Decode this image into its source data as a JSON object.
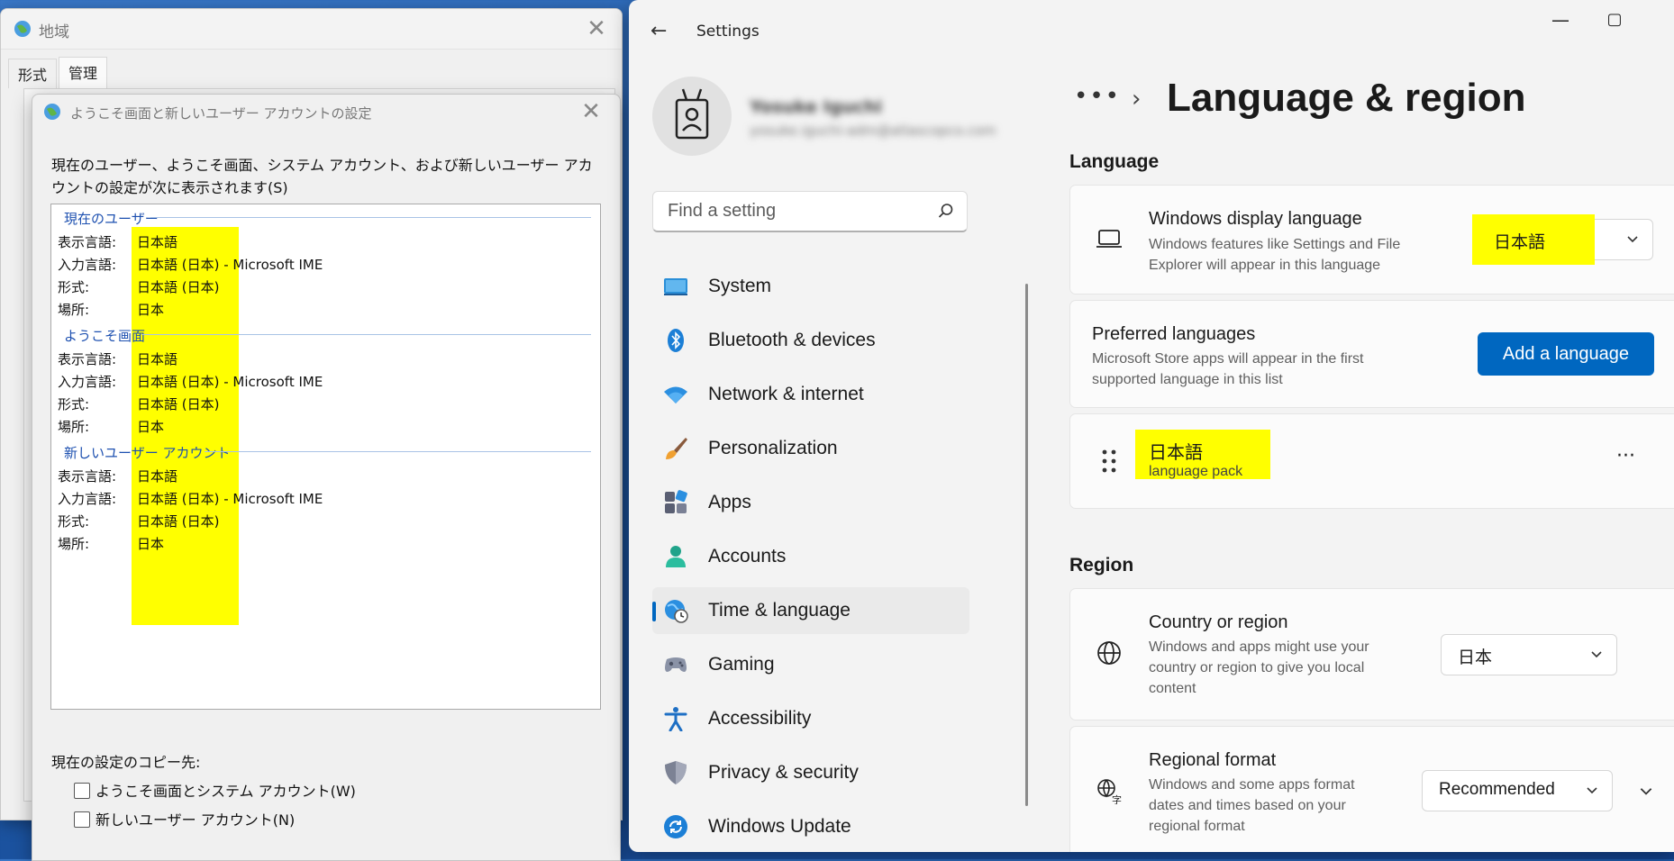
{
  "region_dialog": {
    "title": "地域",
    "tabs": [
      "形式",
      "管理"
    ]
  },
  "welcome_dialog": {
    "title": "ようこそ画面と新しいユーザー アカウントの設定",
    "description": "現在のユーザー、ようこそ画面、システム アカウント、および新しいユーザー アカウントの設定が次に表示されます(S)",
    "sections": [
      {
        "heading": "現在のユーザー",
        "rows": [
          {
            "label": "表示言語:",
            "value": "日本語",
            "extra": ""
          },
          {
            "label": "入力言語:",
            "value": "日本語 (日本)",
            "extra": " - Microsoft IME"
          },
          {
            "label": "形式:",
            "value": "日本語 (日本)",
            "extra": ""
          },
          {
            "label": "場所:",
            "value": "日本",
            "extra": ""
          }
        ]
      },
      {
        "heading": "ようこそ画面",
        "rows": [
          {
            "label": "表示言語:",
            "value": "日本語",
            "extra": ""
          },
          {
            "label": "入力言語:",
            "value": "日本語 (日本)",
            "extra": " - Microsoft IME"
          },
          {
            "label": "形式:",
            "value": "日本語 (日本)",
            "extra": ""
          },
          {
            "label": "場所:",
            "value": "日本",
            "extra": ""
          }
        ]
      },
      {
        "heading": "新しいユーザー アカウント",
        "rows": [
          {
            "label": "表示言語:",
            "value": "日本語",
            "extra": ""
          },
          {
            "label": "入力言語:",
            "value": "日本語 (日本)",
            "extra": " - Microsoft IME"
          },
          {
            "label": "形式:",
            "value": "日本語 (日本)",
            "extra": ""
          },
          {
            "label": "場所:",
            "value": "日本",
            "extra": ""
          }
        ]
      }
    ],
    "copy_label": "現在の設定のコピー先:",
    "checkbox_welcome": "ようこそ画面とシステム アカウント(W)",
    "checkbox_newuser": "新しいユーザー アカウント(N)"
  },
  "settings": {
    "app_title": "Settings",
    "user_name": "Yosuke Iguchi",
    "user_email": "yosuke.iguchi-adm@atlascopco.com",
    "search_placeholder": "Find a setting",
    "nav": [
      {
        "label": "System",
        "icon": "system-icon"
      },
      {
        "label": "Bluetooth & devices",
        "icon": "bluetooth-icon"
      },
      {
        "label": "Network & internet",
        "icon": "wifi-icon"
      },
      {
        "label": "Personalization",
        "icon": "brush-icon"
      },
      {
        "label": "Apps",
        "icon": "apps-icon"
      },
      {
        "label": "Accounts",
        "icon": "accounts-icon"
      },
      {
        "label": "Time & language",
        "icon": "time-language-icon",
        "selected": true
      },
      {
        "label": "Gaming",
        "icon": "gamepad-icon"
      },
      {
        "label": "Accessibility",
        "icon": "accessibility-icon"
      },
      {
        "label": "Privacy & security",
        "icon": "shield-icon"
      },
      {
        "label": "Windows Update",
        "icon": "update-icon"
      }
    ],
    "breadcrumb_more": "•••",
    "page_title": "Language & region",
    "language_section": "Language",
    "display_language": {
      "title": "Windows display language",
      "subtitle": "Windows features like Settings and File Explorer will appear in this language",
      "value": "日本語"
    },
    "preferred_languages": {
      "title": "Preferred languages",
      "subtitle": "Microsoft Store apps will appear in the first supported language in this list",
      "button": "Add a language"
    },
    "language_item": {
      "name": "日本語",
      "detail": "language pack"
    },
    "region_section": "Region",
    "country": {
      "title": "Country or region",
      "subtitle": "Windows and apps might use your country or region to give you local content",
      "value": "日本"
    },
    "regional_format": {
      "title": "Regional format",
      "subtitle": "Windows and some apps format dates and times based on your regional format",
      "value": "Recommended"
    }
  },
  "colors": {
    "accent": "#0067c0",
    "highlight": "#ffff00",
    "section_heading": "#1d50b0"
  }
}
